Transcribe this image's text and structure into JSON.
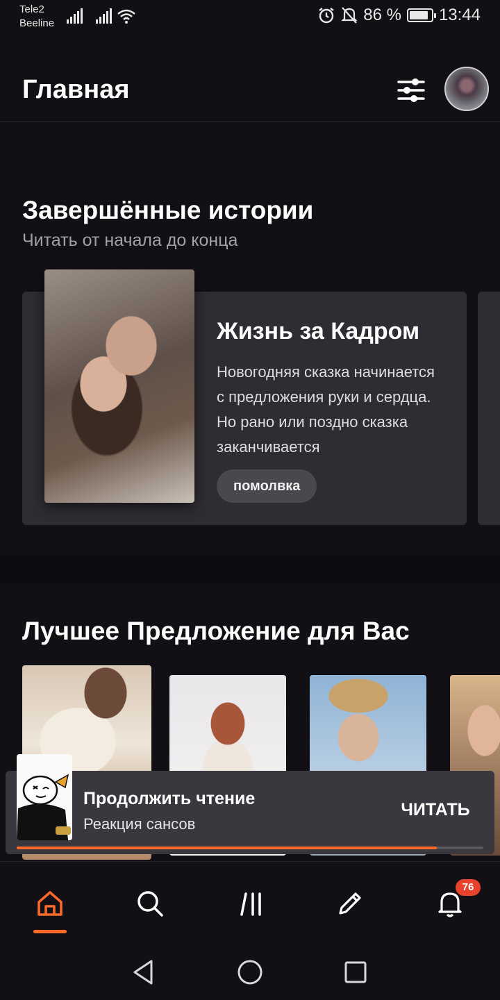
{
  "status_bar": {
    "carrier1": "Tele2",
    "carrier2": "Beeline",
    "battery_percent": "86 %",
    "time": "13:44"
  },
  "header": {
    "title": "Главная"
  },
  "completed": {
    "title": "Завершённые истории",
    "subtitle": "Читать от начала до конца",
    "book": {
      "title": "Жизнь за Кадром",
      "description": "Новогодняя сказка начинается с предложения руки и сердца. Но рано или поздно сказка заканчивается",
      "tag": "помолвка"
    }
  },
  "recommendations": {
    "title": "Лучшее Предложение для Вас"
  },
  "continue_reading": {
    "title": "Продолжить чтение",
    "story": "Реакция сансов",
    "button": "ЧИТАТЬ",
    "progress": 0.9
  },
  "nav": {
    "notifications_count": "76"
  },
  "icons": {
    "filter": "sliders-icon",
    "home": "home-icon",
    "search": "search-icon",
    "library": "library-icon",
    "write": "pencil-icon",
    "notifications": "bell-icon"
  },
  "colors": {
    "accent": "#ff6a2b",
    "background": "#121015",
    "card": "#2f2d33",
    "badge": "#e8412c"
  }
}
